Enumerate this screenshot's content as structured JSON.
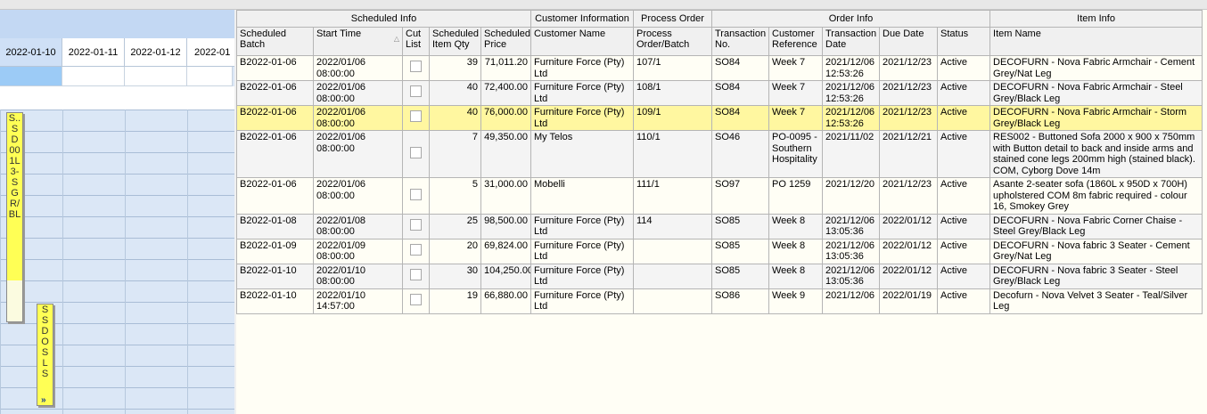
{
  "schedule": {
    "dates": [
      "2022-01-10",
      "2022-01-11",
      "2022-01-12",
      "2022-01"
    ],
    "bars": [
      {
        "text": "S..\nS\nD\n00\n1L\n3-\nS\nG\nR/\nBL"
      },
      {
        "text": "S\nS\nD\nO\nS\nL\nS"
      }
    ],
    "scroll_icon": "chevron-double-down-icon"
  },
  "grid": {
    "bands": {
      "scheduled_info": "Scheduled Info",
      "customer_information": "Customer Information",
      "process_order": "Process Order",
      "order_info": "Order Info",
      "item_info": "Item Info"
    },
    "columns": {
      "batch": "Scheduled Batch",
      "start_time": "Start Time",
      "cut_list": "Cut List",
      "qty": "Scheduled Item Qty",
      "price": "Scheduled Price",
      "customer": "Customer Name",
      "po_batch": "Process Order/Batch",
      "txn_no": "Transaction No.",
      "cust_ref": "Customer Reference",
      "txn_date": "Transaction Date",
      "due_date": "Due Date",
      "status": "Status",
      "item": "Item Name"
    },
    "rows": [
      {
        "batch": "B2022-01-06",
        "start": "2022/01/06 08:00:00",
        "qty": "39",
        "price": "71,011.20",
        "customer": "Furniture Force (Pty) Ltd",
        "po": "107/1",
        "txn": "SO84",
        "ref": "Week 7",
        "tdate": "2021/12/06 12:53:26",
        "due": "2021/12/23",
        "status": "Active",
        "item": "DECOFURN - Nova Fabric Armchair - Cement Grey/Nat Leg"
      },
      {
        "batch": "B2022-01-06",
        "start": "2022/01/06 08:00:00",
        "qty": "40",
        "price": "72,400.00",
        "customer": "Furniture Force (Pty) Ltd",
        "po": "108/1",
        "txn": "SO84",
        "ref": "Week 7",
        "tdate": "2021/12/06 12:53:26",
        "due": "2021/12/23",
        "status": "Active",
        "item": "DECOFURN - Nova Fabric Armchair - Steel Grey/Black Leg"
      },
      {
        "batch": "B2022-01-06",
        "start": "2022/01/06 08:00:00",
        "qty": "40",
        "price": "76,000.00",
        "customer": "Furniture Force (Pty) Ltd",
        "po": "109/1",
        "txn": "SO84",
        "ref": "Week 7",
        "tdate": "2021/12/06 12:53:26",
        "due": "2021/12/23",
        "status": "Active",
        "item": "DECOFURN - Nova Fabric Armchair - Storm Grey/Black Leg"
      },
      {
        "batch": "B2022-01-06",
        "start": "2022/01/06 08:00:00",
        "qty": "7",
        "price": "49,350.00",
        "customer": "My Telos",
        "po": "110/1",
        "txn": "SO46",
        "ref": "PO-0095 - Southern Hospitality",
        "tdate": "2021/11/02",
        "due": "2021/12/21",
        "status": "Active",
        "item": "RES002 - Buttoned Sofa 2000 x 900 x 750mm with Button detail to back and inside arms and stained cone legs 200mm high (stained black). COM, Cyborg Dove 14m"
      },
      {
        "batch": "B2022-01-06",
        "start": "2022/01/06 08:00:00",
        "qty": "5",
        "price": "31,000.00",
        "customer": "Mobelli",
        "po": "111/1",
        "txn": "SO97",
        "ref": "PO 1259",
        "tdate": "2021/12/20",
        "due": "2021/12/23",
        "status": "Active",
        "item": "Asante 2-seater sofa (1860L x 950D x  700H) upholstered COM 8m fabric required - colour 16, Smokey Grey"
      },
      {
        "batch": "B2022-01-08",
        "start": "2022/01/08 08:00:00",
        "qty": "25",
        "price": "98,500.00",
        "customer": "Furniture Force (Pty) Ltd",
        "po": "114",
        "txn": "SO85",
        "ref": "Week 8",
        "tdate": "2021/12/06 13:05:36",
        "due": "2022/01/12",
        "status": "Active",
        "item": "DECOFURN - Nova Fabric Corner Chaise - Steel Grey/Black Leg"
      },
      {
        "batch": "B2022-01-09",
        "start": "2022/01/09 08:00:00",
        "qty": "20",
        "price": "69,824.00",
        "customer": "Furniture Force (Pty) Ltd",
        "po": "",
        "txn": "SO85",
        "ref": "Week 8",
        "tdate": "2021/12/06 13:05:36",
        "due": "2022/01/12",
        "status": "Active",
        "item": "DECOFURN - Nova fabric 3 Seater - Cement Grey/Nat Leg"
      },
      {
        "batch": "B2022-01-10",
        "start": "2022/01/10 08:00:00",
        "qty": "30",
        "price": "104,250.00",
        "customer": "Furniture Force (Pty) Ltd",
        "po": "",
        "txn": "SO85",
        "ref": "Week 8",
        "tdate": "2021/12/06 13:05:36",
        "due": "2022/01/12",
        "status": "Active",
        "item": "DECOFURN - Nova fabric 3 Seater - Steel Grey/Black Leg"
      },
      {
        "batch": "B2022-01-10",
        "start": "2022/01/10 14:57:00",
        "qty": "19",
        "price": "66,880.00",
        "customer": "Furniture Force (Pty) Ltd",
        "po": "",
        "txn": "SO86",
        "ref": "Week 9",
        "tdate": "2021/12/06",
        "due": "2022/01/19",
        "status": "Active",
        "item": "Decofurn - Nova Velvet 3 Seater - Teal/Silver Leg"
      }
    ],
    "highlight_row": 2
  }
}
